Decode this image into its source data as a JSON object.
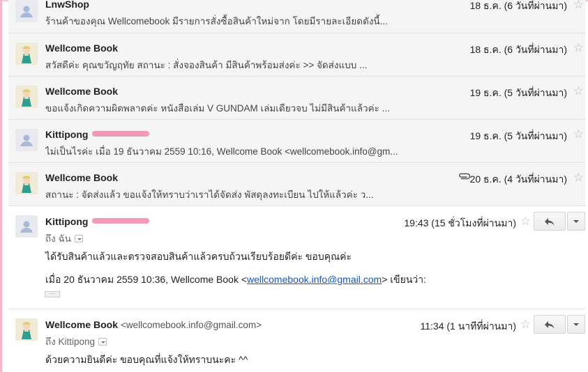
{
  "colors": {
    "accent_pink": "#f28fb5",
    "link": "#1155cc",
    "collapsed_bg": "#f5f5f5"
  },
  "icons": {
    "star": "☆",
    "paperclip": "paperclip-icon",
    "reply": "reply-icon",
    "more": "chevron-down-icon"
  },
  "messages": [
    {
      "sender": "LnwShop",
      "snippet": "ร้านค้าของคุณ Wellcomebook มีรายการสั่งซื้อสินค้าใหม่จาก โดยมีรายละเอียดดังนี้...",
      "date": "18 ธ.ค. (6 วันที่ผ่านมา)"
    },
    {
      "sender": "Wellcome Book",
      "snippet": "สวัสดีค่ะ คุณขวัญฤทัย สถานะ : สั่งจองสินค้า มีสินค้าพร้อมส่งค่ะ >> จัดส่งแบบ ...",
      "date": "18 ธ.ค. (6 วันที่ผ่านมา)"
    },
    {
      "sender": "Wellcome Book",
      "snippet": "ขอแจ้งเกิดความผิดพลาดค่ะ หนังสือเล่ม V GUNDAM เล่มเดียวจบ ไม่มีสินค้าแล้วค่ะ ...",
      "date": "19 ธ.ค. (5 วันที่ผ่านมา)"
    },
    {
      "sender": "Kittipong",
      "snippet": "ไม่เป็นไรค่ะ เมื่อ 19 ธันวาคม 2559 10:16, Wellcome Book <wellcomebook.info@gm...",
      "date": "19 ธ.ค. (5 วันที่ผ่านมา)"
    },
    {
      "sender": "Wellcome Book",
      "snippet": "สถานะ : จัดส่งแล้ว ขอแจ้งให้ทราบว่าเราได้จัดส่ง พัสดุลงทะเบียน ไปให้แล้วค่ะ ว...",
      "date": "20 ธ.ค. (4 วันที่ผ่านมา)"
    }
  ],
  "open_messages": [
    {
      "sender": "Kittipong",
      "to": "ถึง ฉัน",
      "time": "19:43 (15 ชั่วโมงที่ผ่านมา)",
      "body": "ได้รับสินค้าแล้วและตรวจสอบสินค้าแล้วครบถ้วนเรียบร้อยดีค่ะ ขอบคุณค่ะ",
      "quote_prefix": "เมื่อ 20 ธันวาคม 2559 10:36, Wellcome Book <",
      "quote_link": "wellcomebook.info@gmail.com",
      "quote_suffix": "> เขียนว่า:",
      "ellipsis": "···"
    },
    {
      "sender": "Wellcome Book",
      "sender_email": "<wellcomebook.info@gmail.com>",
      "to": "ถึง Kittipong",
      "time": "11:34 (1 นาทีที่ผ่านมา)",
      "body": "ด้วยความยินดีค่ะ ขอบคุณที่แจ้งให้ทราบนะคะ ^^"
    }
  ]
}
